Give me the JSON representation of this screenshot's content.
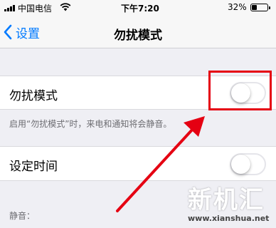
{
  "status_bar": {
    "carrier": "中国电信",
    "time": "下午7:20",
    "battery_percent": "32%",
    "battery_level": 0.32
  },
  "nav": {
    "back_label": "设置",
    "title": "勿扰模式"
  },
  "settings": {
    "dnd_label": "勿扰模式",
    "dnd_enabled": false,
    "dnd_footnote": "启用“勿扰模式”时，来电和通知将会静音。",
    "scheduled_label": "设定时间",
    "scheduled_enabled": false,
    "silence_header": "静音："
  },
  "annotation": {
    "color": "#e50012"
  },
  "watermark": {
    "brand": "新机汇",
    "url": "www.xianshua.net"
  },
  "colors": {
    "accent": "#007aff",
    "background": "#efeff4"
  }
}
